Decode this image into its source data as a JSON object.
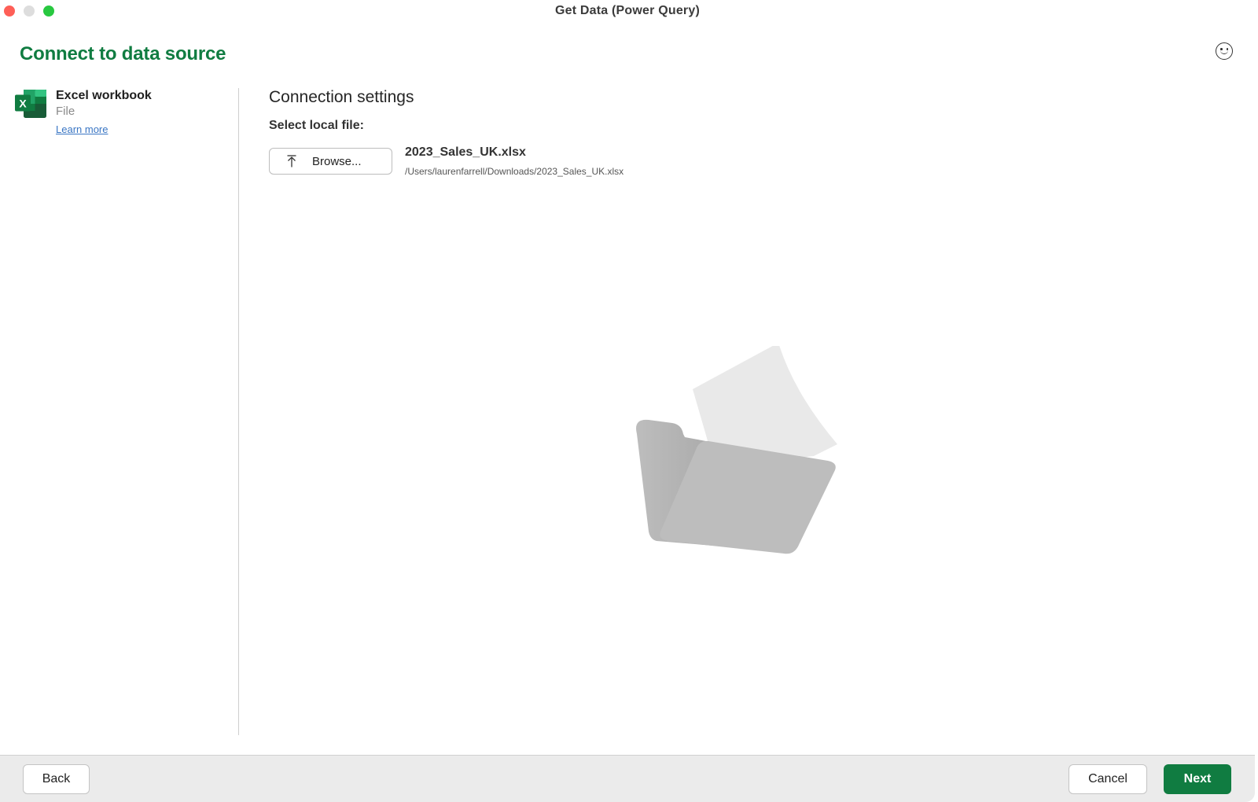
{
  "window": {
    "title": "Get Data (Power Query)",
    "controls": [
      "close",
      "minimize",
      "maximize"
    ]
  },
  "header": {
    "title": "Connect to data source",
    "feedback_icon": "smiley-face-icon"
  },
  "sidebar": {
    "source": {
      "icon": "excel-icon",
      "name": "Excel workbook",
      "type": "File",
      "link": "Learn more"
    }
  },
  "main": {
    "section_title": "Connection settings",
    "field_label": "Select local file:",
    "browse_button": {
      "label": "Browse...",
      "icon": "upload-arrow-icon"
    },
    "selected_file": {
      "name": "2023_Sales_UK.xlsx",
      "path": "/Users/laurenfarrell/Downloads/2023_Sales_UK.xlsx"
    },
    "illustration": "folder-with-document-icon"
  },
  "footer": {
    "back_label": "Back",
    "cancel_label": "Cancel",
    "next_label": "Next"
  },
  "colors": {
    "accent": "#107c41",
    "link": "#3a76c4",
    "close": "#fe5f57",
    "minimize": "#dddddd",
    "maximize": "#28c840"
  }
}
